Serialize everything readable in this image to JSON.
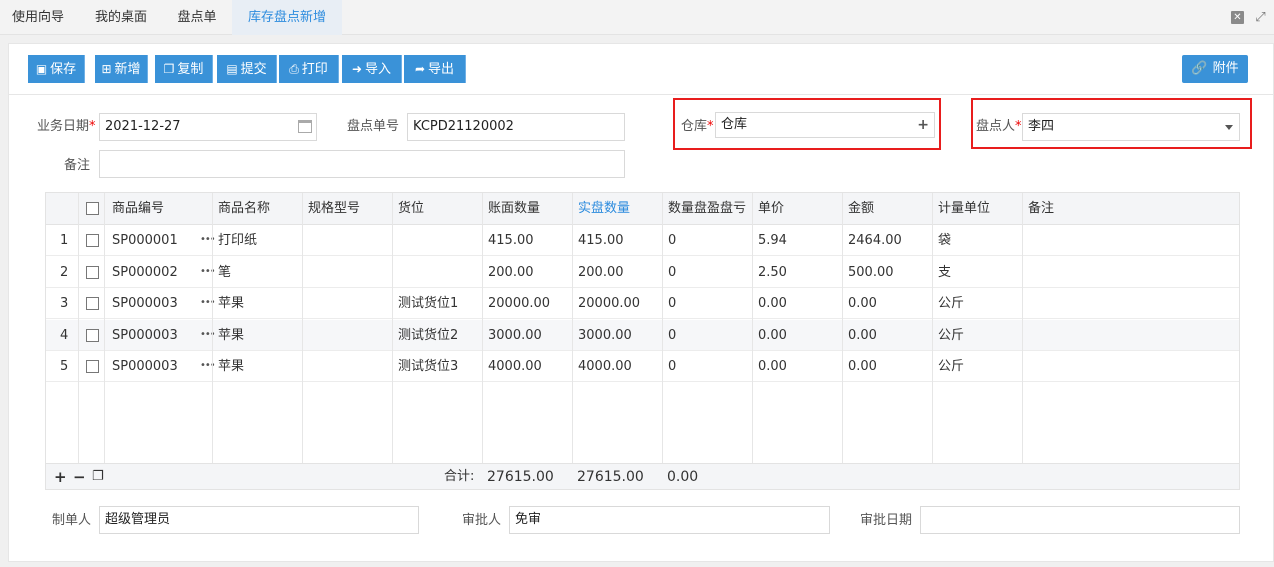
{
  "tabs": [
    {
      "label": "使用向导",
      "active": false
    },
    {
      "label": "我的桌面",
      "active": false
    },
    {
      "label": "盘点单",
      "active": false
    },
    {
      "label": "库存盘点新增",
      "active": true
    }
  ],
  "toolbar": {
    "buttons": [
      {
        "label": "保存",
        "icon": "save-icon"
      },
      {
        "label": "新增",
        "icon": "plus-square-icon"
      },
      {
        "label": "复制",
        "icon": "copy-icon"
      },
      {
        "label": "提交",
        "icon": "document-icon"
      },
      {
        "label": "打印",
        "icon": "print-icon"
      },
      {
        "label": "导入",
        "icon": "import-icon"
      },
      {
        "label": "导出",
        "icon": "export-icon"
      }
    ],
    "attach_label": "附件"
  },
  "form": {
    "biz_date_label": "业务日期",
    "biz_date_value": "2021-12-27",
    "doc_no_label": "盘点单号",
    "doc_no_value": "KCPD21120002",
    "warehouse_label": "仓库",
    "warehouse_value": "仓库",
    "counter_label": "盘点人",
    "counter_value": "李四",
    "remark_label": "备注",
    "remark_value": "",
    "required_mark": "*"
  },
  "grid": {
    "headers": [
      "商品编号",
      "商品名称",
      "规格型号",
      "货位",
      "账面数量",
      "实盘数量",
      "数量盘盈盘亏",
      "单价",
      "金额",
      "计量单位",
      "备注"
    ],
    "rows": [
      {
        "no": "1",
        "code": "SP000001",
        "name": "打印纸",
        "spec": "",
        "loc": "",
        "book": "415.00",
        "actual": "415.00",
        "diff": "0",
        "price": "5.94",
        "amount": "2464.00",
        "unit": "袋",
        "remark": ""
      },
      {
        "no": "2",
        "code": "SP000002",
        "name": "笔",
        "spec": "",
        "loc": "",
        "book": "200.00",
        "actual": "200.00",
        "diff": "0",
        "price": "2.50",
        "amount": "500.00",
        "unit": "支",
        "remark": ""
      },
      {
        "no": "3",
        "code": "SP000003",
        "name": "苹果",
        "spec": "",
        "loc": "测试货位1",
        "book": "20000.00",
        "actual": "20000.00",
        "diff": "0",
        "price": "0.00",
        "amount": "0.00",
        "unit": "公斤",
        "remark": ""
      },
      {
        "no": "4",
        "code": "SP000003",
        "name": "苹果",
        "spec": "",
        "loc": "测试货位2",
        "book": "3000.00",
        "actual": "3000.00",
        "diff": "0",
        "price": "0.00",
        "amount": "0.00",
        "unit": "公斤",
        "remark": ""
      },
      {
        "no": "5",
        "code": "SP000003",
        "name": "苹果",
        "spec": "",
        "loc": "测试货位3",
        "book": "4000.00",
        "actual": "4000.00",
        "diff": "0",
        "price": "0.00",
        "amount": "0.00",
        "unit": "公斤",
        "remark": ""
      }
    ],
    "total_label": "合计:",
    "total_book": "27615.00",
    "total_actual": "27615.00",
    "total_diff": "0.00",
    "dots": "•••"
  },
  "bottom": {
    "maker_label": "制单人",
    "maker_value": "超级管理员",
    "approver_label": "审批人",
    "approver_value": "免审",
    "approve_date_label": "审批日期",
    "approve_date_value": ""
  }
}
